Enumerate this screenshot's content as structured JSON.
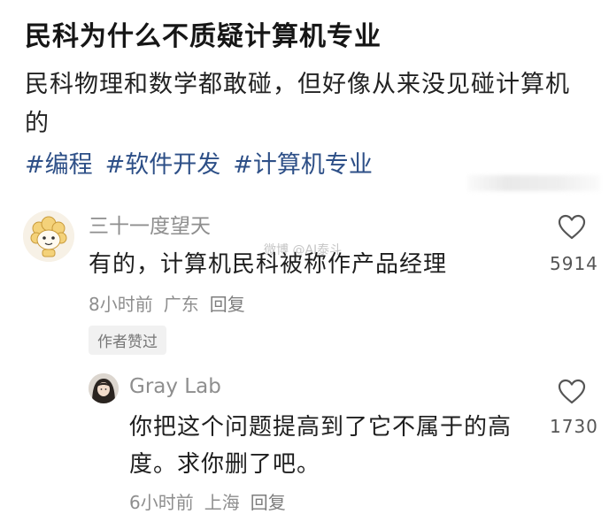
{
  "post": {
    "title": "民科为什么不质疑计算机专业",
    "body": "民科物理和数学都敢碰，但好像从来没见碰计算机的",
    "tags": [
      "#编程",
      "#软件开发",
      "#计算机专业"
    ]
  },
  "watermark": "微博 @AI泰斗",
  "comments": [
    {
      "author": "三十一度望天",
      "text": "有的，计算机民科被称作产品经理",
      "time": "8小时前",
      "location": "广东",
      "reply_label": "回复",
      "badge": "作者赞过",
      "likes": "5914"
    },
    {
      "author": "Gray Lab",
      "text": "你把这个问题提高到了它不属于的高度。求你删了吧。",
      "time": "6小时前",
      "location": "上海",
      "reply_label": "回复",
      "likes": "1730"
    }
  ],
  "icons": {
    "like": "heart-outline-icon",
    "avatar1": "sheep-cartoon-avatar",
    "avatar2": "person-photo-avatar"
  },
  "colors": {
    "tag": "#2d4f87",
    "muted": "#8e8e8e"
  }
}
